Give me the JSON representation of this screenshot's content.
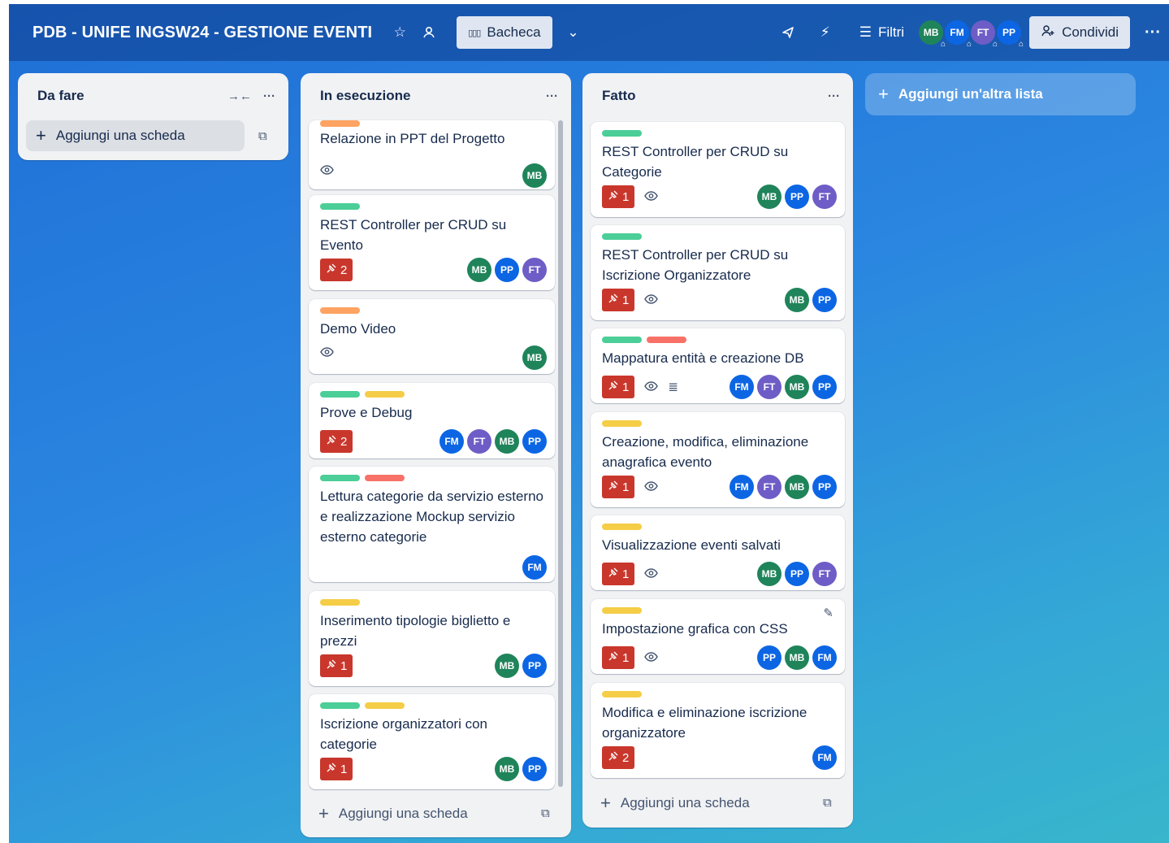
{
  "board": {
    "title": "PDB - UNIFE INGSW24 - GESTIONE EVENTI",
    "view_label": "Bacheca",
    "view_icon": "board-icon",
    "filter_label": "Filtri",
    "share_label": "Condividi",
    "header_members": [
      "MB",
      "FM",
      "FT",
      "PP"
    ]
  },
  "colors": {
    "label_green": "#4bce97",
    "label_orange": "#fea362",
    "label_yellow": "#f5cd47",
    "label_red": "#f87168",
    "avatar_MB": "#1f845a",
    "avatar_PP": "#0c66e4",
    "avatar_FT": "#6e5dc6",
    "avatar_FM": "#0c66e4",
    "overdue_badge": "#c9372c"
  },
  "lists": [
    {
      "title": "Da fare",
      "add_card_label": "Aggiungi una scheda",
      "cards": []
    },
    {
      "title": "In esecuzione",
      "add_card_label": "Aggiungi una scheda",
      "cards": [
        {
          "labels": [
            "orange"
          ],
          "title": "Relazione in PPT del Progetto",
          "pins": null,
          "watch": true,
          "members": [
            "MB"
          ]
        },
        {
          "labels": [
            "green"
          ],
          "title": "REST Controller per CRUD su Evento",
          "pins": "2",
          "watch": false,
          "members": [
            "MB",
            "PP",
            "FT"
          ]
        },
        {
          "labels": [
            "orange"
          ],
          "title": "Demo Video",
          "pins": null,
          "watch": true,
          "members": [
            "MB"
          ]
        },
        {
          "labels": [
            "green",
            "yellow"
          ],
          "title": "Prove e Debug",
          "pins": "2",
          "watch": false,
          "members": [
            "FM",
            "FT",
            "MB",
            "PP"
          ]
        },
        {
          "labels": [
            "green",
            "red"
          ],
          "title": "Lettura categorie da servizio esterno e realizzazione Mockup servizio esterno categorie",
          "pins": null,
          "watch": false,
          "members": [
            "FM"
          ]
        },
        {
          "labels": [
            "yellow"
          ],
          "title": "Inserimento tipologie biglietto e prezzi",
          "pins": "1",
          "watch": false,
          "members": [
            "MB",
            "PP"
          ]
        },
        {
          "labels": [
            "green",
            "yellow"
          ],
          "title": "Iscrizione organizzatori con categorie",
          "pins": "1",
          "watch": false,
          "members": [
            "MB",
            "PP"
          ]
        }
      ]
    },
    {
      "title": "Fatto",
      "add_card_label": "Aggiungi una scheda",
      "cards": [
        {
          "labels": [
            "green"
          ],
          "title": "REST Controller per CRUD su Categorie",
          "pins": "1",
          "watch": true,
          "members": [
            "MB",
            "PP",
            "FT"
          ]
        },
        {
          "labels": [
            "green"
          ],
          "title": "REST Controller per CRUD su Iscrizione Organizzatore",
          "pins": "1",
          "watch": true,
          "members": [
            "MB",
            "PP"
          ]
        },
        {
          "labels": [
            "green",
            "red"
          ],
          "title": "Mappatura entità e creazione DB",
          "pins": "1",
          "watch": true,
          "description": true,
          "members": [
            "FM",
            "FT",
            "MB",
            "PP"
          ]
        },
        {
          "labels": [
            "yellow"
          ],
          "title": "Creazione, modifica, eliminazione anagrafica evento",
          "pins": "1",
          "watch": true,
          "members": [
            "FM",
            "FT",
            "MB",
            "PP"
          ]
        },
        {
          "labels": [
            "yellow"
          ],
          "title": "Visualizzazione eventi salvati",
          "pins": "1",
          "watch": true,
          "members": [
            "MB",
            "PP",
            "FT"
          ]
        },
        {
          "labels": [
            "yellow"
          ],
          "title": "Impostazione grafica con CSS",
          "pins": "1",
          "watch": true,
          "edit": true,
          "members": [
            "PP",
            "MB",
            "FM"
          ]
        },
        {
          "labels": [
            "yellow"
          ],
          "title": "Modifica e eliminazione iscrizione organizzatore",
          "pins": "2",
          "watch": false,
          "members": [
            "FM"
          ]
        }
      ]
    }
  ],
  "add_list_label": "Aggiungi un'altra lista"
}
